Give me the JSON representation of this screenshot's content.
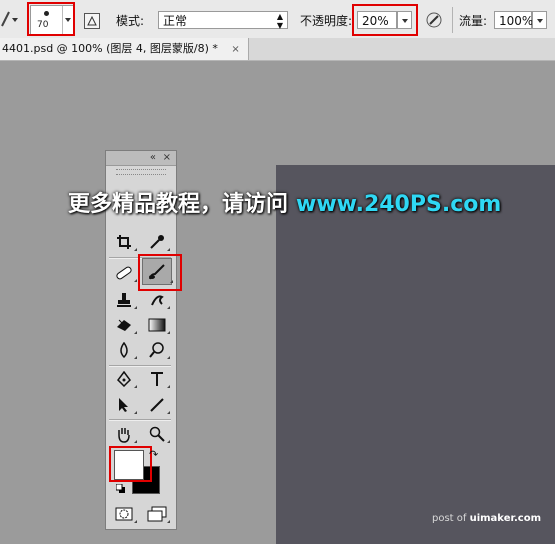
{
  "options_bar": {
    "brush_size": "70",
    "mode_label": "模式:",
    "mode_value": "正常",
    "opacity_label": "不透明度:",
    "opacity_value": "20%",
    "flow_label": "流量:",
    "flow_value": "100%"
  },
  "document_tab": {
    "title": "4401.psd @ 100% (图层 4, 图层蒙版/8) *",
    "close_glyph": "×"
  },
  "toolbox": {
    "collapse_glyph": "«",
    "close_glyph": "×",
    "tools": [
      {
        "name": "crop",
        "icon": "crop-icon",
        "glyph": "⌗"
      },
      {
        "name": "eyedropper",
        "icon": "eyedropper-icon",
        "glyph": "✎"
      },
      {
        "name": "healing-brush",
        "icon": "bandage-icon",
        "glyph": "⊘"
      },
      {
        "name": "brush",
        "icon": "brush-icon",
        "glyph": "🖌",
        "selected": true
      },
      {
        "name": "clone-stamp",
        "icon": "stamp-icon",
        "glyph": "⊥"
      },
      {
        "name": "history-brush",
        "icon": "history-brush-icon",
        "glyph": "↺"
      },
      {
        "name": "eraser",
        "icon": "eraser-icon",
        "glyph": "⌫"
      },
      {
        "name": "gradient",
        "icon": "gradient-icon",
        "glyph": "▭"
      },
      {
        "name": "blur",
        "icon": "blur-icon",
        "glyph": "♢"
      },
      {
        "name": "dodge",
        "icon": "dodge-icon",
        "glyph": "⚲"
      },
      {
        "name": "pen",
        "icon": "pen-icon",
        "glyph": "✒"
      },
      {
        "name": "type",
        "icon": "type-icon",
        "glyph": "T"
      },
      {
        "name": "path-selection",
        "icon": "arrow-cursor-icon",
        "glyph": "➤"
      },
      {
        "name": "line",
        "icon": "line-icon",
        "glyph": "╱"
      },
      {
        "name": "hand",
        "icon": "hand-icon",
        "glyph": "✋"
      },
      {
        "name": "zoom",
        "icon": "zoom-icon",
        "glyph": "⚲"
      }
    ],
    "foreground_color": "#ffffff",
    "background_color": "#000000"
  },
  "watermark": {
    "text": "更多精品教程，请访问",
    "url": "www.240PS.com"
  },
  "credit": {
    "prefix": "post of ",
    "site": "uimaker.com"
  },
  "colors": {
    "highlight": "#e00000",
    "document_fill": "#56555e",
    "workspace": "#9b9b9b"
  }
}
